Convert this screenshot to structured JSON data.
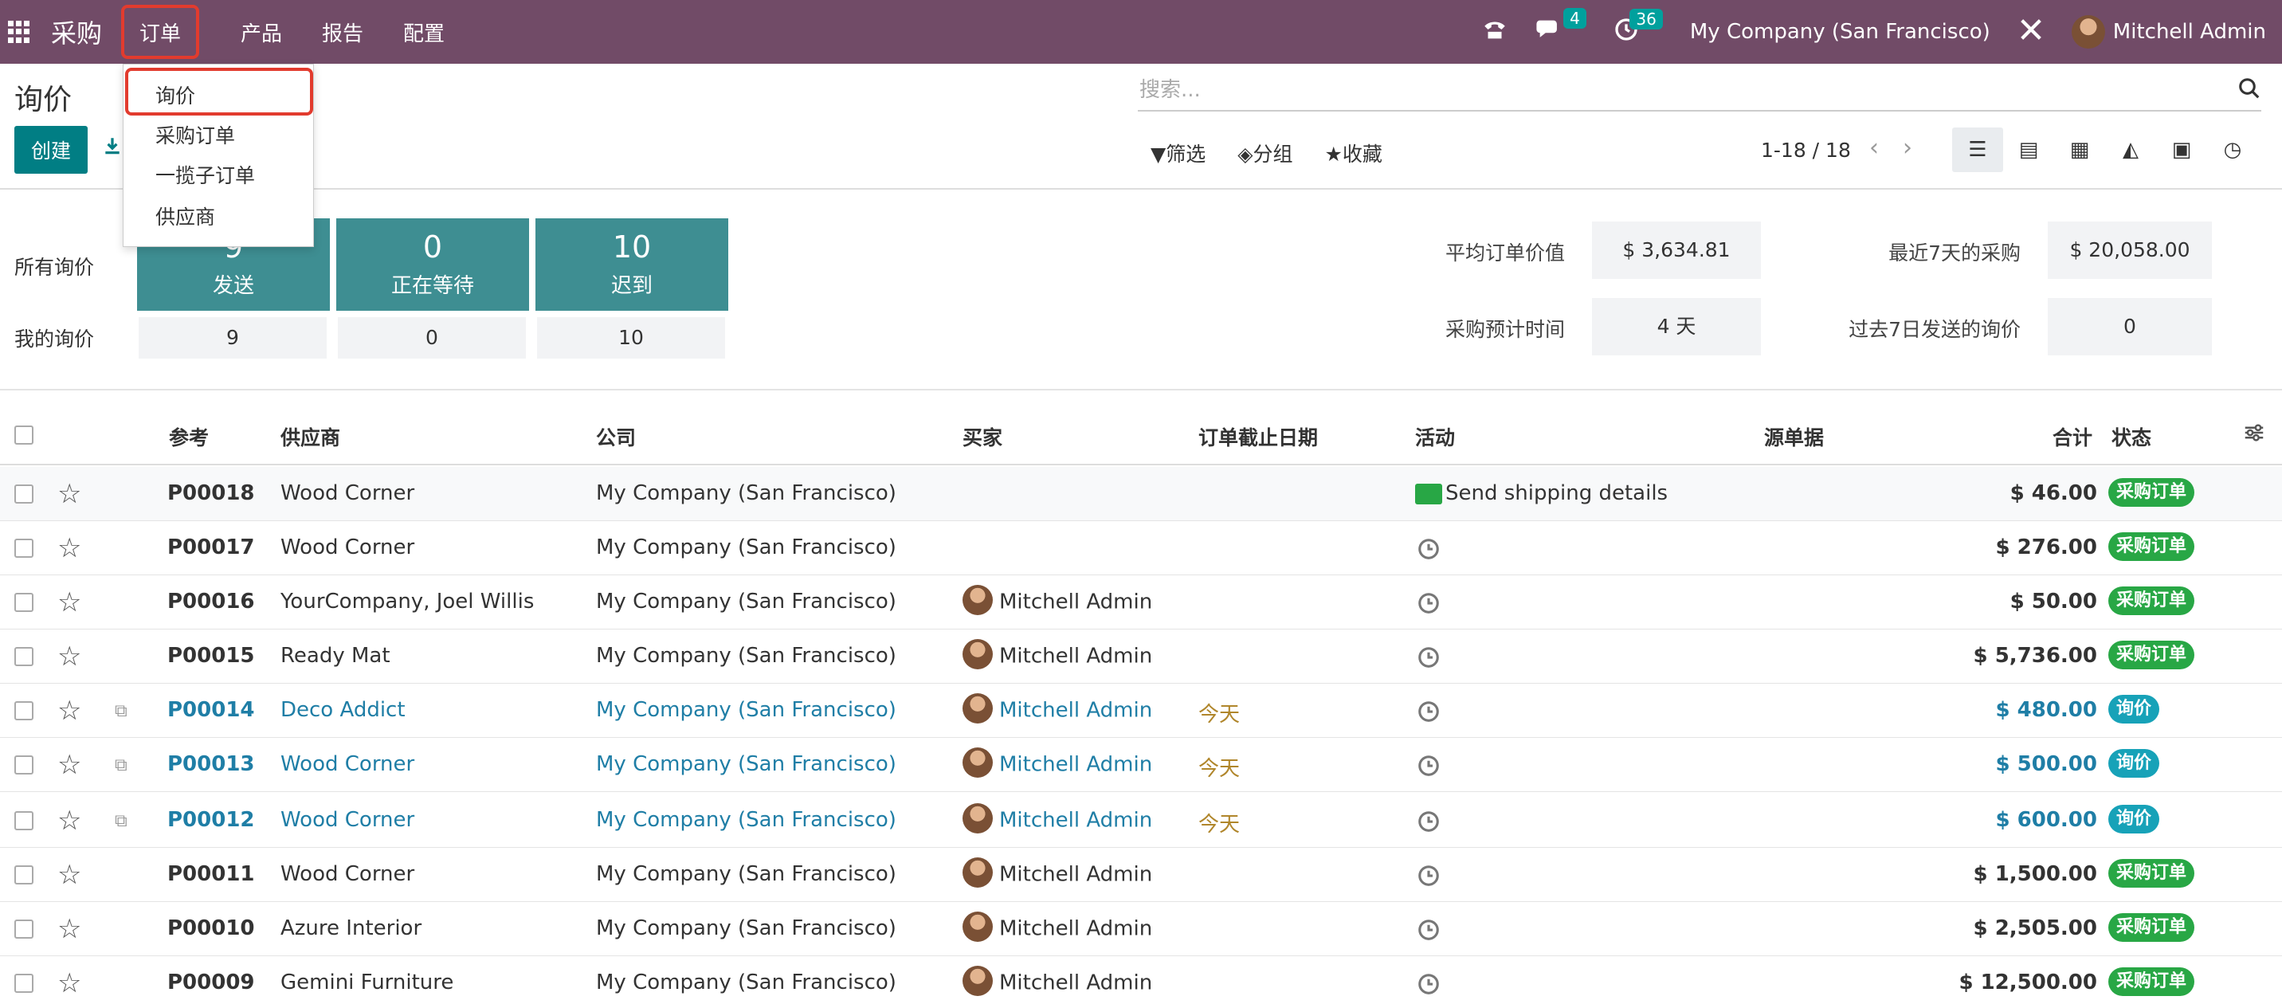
{
  "navbar": {
    "app_title": "采购",
    "menu": [
      "订单",
      "产品",
      "报告",
      "配置"
    ],
    "messages_count": "4",
    "activities_count": "36",
    "company": "My Company (San Francisco)",
    "user": "Mitchell Admin"
  },
  "dropdown": {
    "items": [
      "询价",
      "采购订单",
      "一揽子订单",
      "供应商"
    ]
  },
  "control": {
    "title": "询价",
    "create_label": "创建",
    "search_placeholder": "搜索...",
    "filter_label": "筛选",
    "group_label": "分组",
    "favorites_label": "收藏",
    "pager": "1-18 / 18"
  },
  "dashboard": {
    "all_rfq_label": "所有询价",
    "my_rfq_label": "我的询价",
    "tiles": [
      {
        "num": "9",
        "label": "发送",
        "mine": "9"
      },
      {
        "num": "0",
        "label": "正在等待",
        "mine": "0"
      },
      {
        "num": "10",
        "label": "迟到",
        "mine": "10"
      }
    ],
    "metrics": {
      "avg_order_label": "平均订单价值",
      "avg_order_value": "$ 3,634.81",
      "last7_label": "最近7天的采购",
      "last7_value": "$ 20,058.00",
      "lead_time_label": "采购预计时间",
      "lead_time_value": "4 天",
      "rfq_sent_label": "过去7日发送的询价",
      "rfq_sent_value": "0"
    }
  },
  "table": {
    "headers": {
      "reference": "参考",
      "vendor": "供应商",
      "company": "公司",
      "buyer": "买家",
      "deadline": "订单截止日期",
      "activity": "活动",
      "source": "源单据",
      "total": "合计",
      "status": "状态"
    },
    "rows": [
      {
        "ref": "P00018",
        "vendor": "Wood Corner",
        "company": "My Company (San Francisco)",
        "buyer": "",
        "deadline": "",
        "activity": "Send shipping details",
        "total": "$ 46.00",
        "status": "采购订单"
      },
      {
        "ref": "P00017",
        "vendor": "Wood Corner",
        "company": "My Company (San Francisco)",
        "buyer": "",
        "deadline": "",
        "activity": "",
        "total": "$ 276.00",
        "status": "采购订单"
      },
      {
        "ref": "P00016",
        "vendor": "YourCompany, Joel Willis",
        "company": "My Company (San Francisco)",
        "buyer": "Mitchell Admin",
        "deadline": "",
        "activity": "",
        "total": "$ 50.00",
        "status": "采购订单"
      },
      {
        "ref": "P00015",
        "vendor": "Ready Mat",
        "company": "My Company (San Francisco)",
        "buyer": "Mitchell Admin",
        "deadline": "",
        "activity": "",
        "total": "$ 5,736.00",
        "status": "采购订单"
      },
      {
        "ref": "P00014",
        "vendor": "Deco Addict",
        "company": "My Company (San Francisco)",
        "buyer": "Mitchell Admin",
        "deadline": "今天",
        "activity": "",
        "total": "$ 480.00",
        "status": "询价"
      },
      {
        "ref": "P00013",
        "vendor": "Wood Corner",
        "company": "My Company (San Francisco)",
        "buyer": "Mitchell Admin",
        "deadline": "今天",
        "activity": "",
        "total": "$ 500.00",
        "status": "询价"
      },
      {
        "ref": "P00012",
        "vendor": "Wood Corner",
        "company": "My Company (San Francisco)",
        "buyer": "Mitchell Admin",
        "deadline": "今天",
        "activity": "",
        "total": "$ 600.00",
        "status": "询价"
      },
      {
        "ref": "P00011",
        "vendor": "Wood Corner",
        "company": "My Company (San Francisco)",
        "buyer": "Mitchell Admin",
        "deadline": "",
        "activity": "",
        "total": "$ 1,500.00",
        "status": "采购订单"
      },
      {
        "ref": "P00010",
        "vendor": "Azure Interior",
        "company": "My Company (San Francisco)",
        "buyer": "Mitchell Admin",
        "deadline": "",
        "activity": "",
        "total": "$ 2,505.00",
        "status": "采购订单"
      },
      {
        "ref": "P00009",
        "vendor": "Gemini Furniture",
        "company": "My Company (San Francisco)",
        "buyer": "Mitchell Admin",
        "deadline": "",
        "activity": "",
        "total": "$ 12,500.00",
        "status": "采购订单"
      }
    ]
  }
}
